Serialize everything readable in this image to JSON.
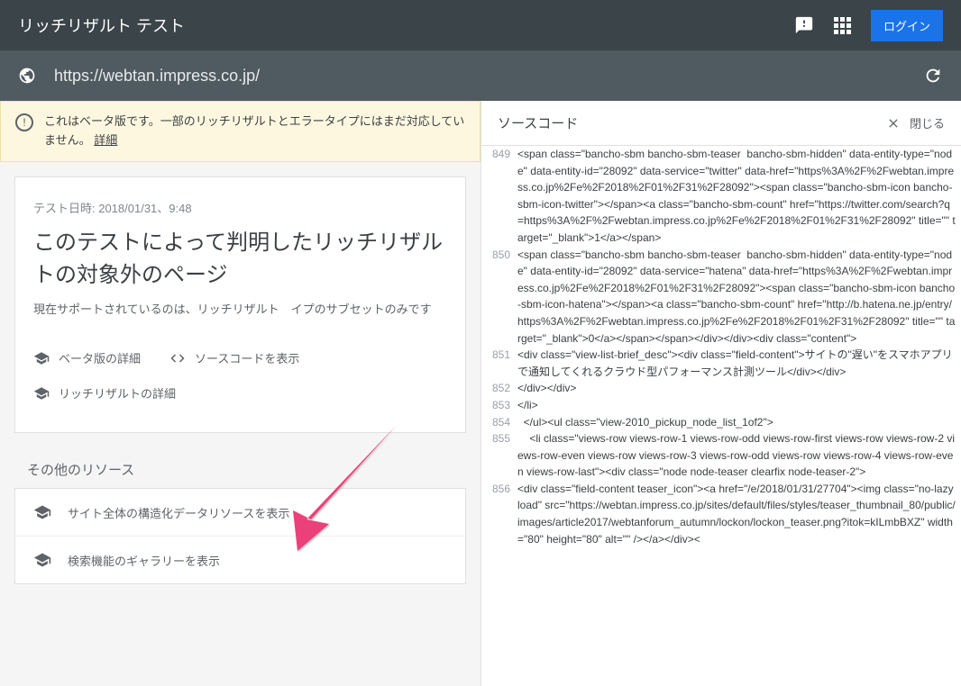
{
  "topbar": {
    "title": "リッチリザルト テスト",
    "login": "ログイン"
  },
  "url": "https://webtan.impress.co.jp/",
  "beta": {
    "text": "これはベータ版です。一部のリッチリザルトとエラータイプにはまだ対応していません。",
    "link": "詳細"
  },
  "card": {
    "date": "テスト日時: 2018/01/31、9:48",
    "title": "このテストによって判明したリッチリザルトの対象外のページ",
    "sub": "現在サポートされているのは、リッチリザルト　イプのサブセットのみです",
    "actions": {
      "beta": "ベータ版の詳細",
      "source": "ソースコードを表示",
      "rich": "リッチリザルトの詳細"
    }
  },
  "resources": {
    "heading": "その他のリソース",
    "items": [
      "サイト全体の構造化データリソースを表示",
      "検索機能のギャラリーを表示"
    ]
  },
  "source": {
    "title": "ソースコード",
    "close": "閉じる",
    "lines": [
      {
        "n": "849",
        "c": "<span class=\"bancho-sbm bancho-sbm-teaser  bancho-sbm-hidden\" data-entity-type=\"node\" data-entity-id=\"28092\" data-service=\"twitter\" data-href=\"https%3A%2F%2Fwebtan.impress.co.jp%2Fe%2F2018%2F01%2F31%2F28092\"><span class=\"bancho-sbm-icon bancho-sbm-icon-twitter\"></span><a class=\"bancho-sbm-count\" href=\"https://twitter.com/search?q=https%3A%2F%2Fwebtan.impress.co.jp%2Fe%2F2018%2F01%2F31%2F28092\" title=\"\" target=\"_blank\">1</a></span>"
      },
      {
        "n": "850",
        "c": "<span class=\"bancho-sbm bancho-sbm-teaser  bancho-sbm-hidden\" data-entity-type=\"node\" data-entity-id=\"28092\" data-service=\"hatena\" data-href=\"https%3A%2F%2Fwebtan.impress.co.jp%2Fe%2F2018%2F01%2F31%2F28092\"><span class=\"bancho-sbm-icon bancho-sbm-icon-hatena\"></span><a class=\"bancho-sbm-count\" href=\"http://b.hatena.ne.jp/entry/https%3A%2F%2Fwebtan.impress.co.jp%2Fe%2F2018%2F01%2F31%2F28092\" title=\"\" target=\"_blank\">0</a></span></span></div></div><div class=\"content\">"
      },
      {
        "n": "851",
        "c": "<div class=\"view-list-brief_desc\"><div class=\"field-content\">サイトの\"遅い\"をスマホアプリで通知してくれるクラウド型パフォーマンス計測ツール</div></div>"
      },
      {
        "n": "852",
        "c": "</div></div>"
      },
      {
        "n": "853",
        "c": "</li>"
      },
      {
        "n": "854",
        "c": "  </ul><ul class=\"view-2010_pickup_node_list_1of2\">"
      },
      {
        "n": "855",
        "c": "    <li class=\"views-row views-row-1 views-row-odd views-row-first views-row views-row-2 views-row-even views-row views-row-3 views-row-odd views-row views-row-4 views-row-even views-row-last\"><div class=\"node node-teaser clearfix node-teaser-2\">"
      },
      {
        "n": "856",
        "c": "<div class=\"field-content teaser_icon\"><a href=\"/e/2018/01/31/27704\"><img class=\"no-lazyload\" src=\"https://webtan.impress.co.jp/sites/default/files/styles/teaser_thumbnail_80/public/images/article2017/webtanforum_autumn/lockon/lockon_teaser.png?itok=kILmbBXZ\" width=\"80\" height=\"80\" alt=\"\" /></a></div><"
      }
    ]
  }
}
